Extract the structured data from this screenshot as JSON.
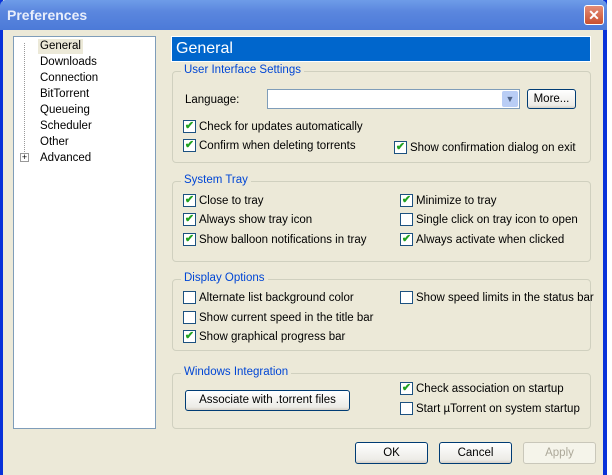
{
  "window": {
    "title": "Preferences",
    "close": "✕"
  },
  "tree": {
    "items": [
      "General",
      "Downloads",
      "Connection",
      "BitTorrent",
      "Queueing",
      "Scheduler",
      "Other",
      "Advanced"
    ],
    "expander": "+"
  },
  "header": "General",
  "ui_settings": {
    "legend": "User Interface Settings",
    "language_label": "Language:",
    "language_value": "",
    "more": "More...",
    "check_updates": "Check for updates automatically",
    "confirm_delete": "Confirm when deleting torrents",
    "confirm_exit": "Show confirmation dialog on exit"
  },
  "tray": {
    "legend": "System Tray",
    "close_to_tray": "Close to tray",
    "always_show": "Always show tray icon",
    "balloon": "Show balloon notifications in tray",
    "minimize": "Minimize to tray",
    "single_click": "Single click on tray icon to open",
    "always_activate": "Always activate when clicked"
  },
  "display": {
    "legend": "Display Options",
    "alternate": "Alternate list background color",
    "speed_title": "Show current speed in the title bar",
    "graphical": "Show graphical progress bar",
    "speed_limits": "Show speed limits in the status bar"
  },
  "integration": {
    "legend": "Windows Integration",
    "associate": "Associate with .torrent files",
    "check_assoc": "Check association on startup",
    "start_startup": "Start µTorrent on system startup"
  },
  "buttons": {
    "ok": "OK",
    "cancel": "Cancel",
    "apply": "Apply"
  },
  "check": "✔",
  "states": {
    "check_updates": true,
    "confirm_delete": true,
    "confirm_exit": true,
    "close_to_tray": true,
    "always_show": true,
    "balloon": true,
    "minimize": true,
    "single_click": false,
    "always_activate": true,
    "alternate": false,
    "speed_title": false,
    "graphical": true,
    "speed_limits": false,
    "check_assoc": true,
    "start_startup": false
  }
}
